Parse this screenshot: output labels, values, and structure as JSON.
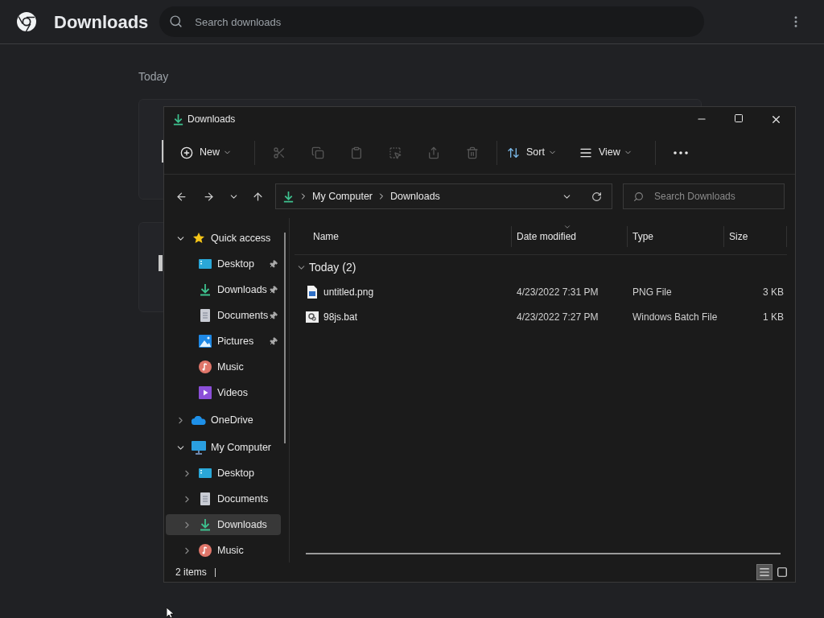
{
  "browser": {
    "title": "Downloads",
    "search": {
      "placeholder": "Search downloads"
    },
    "section": "Today",
    "cards": [
      {
        "kind": "download"
      },
      {
        "kind": "download"
      }
    ]
  },
  "explorer": {
    "title": "Downloads",
    "toolbar": [
      {
        "kind": "new",
        "label": "New",
        "disabled": false
      },
      {
        "kind": "cut",
        "disabled": true
      },
      {
        "kind": "copy",
        "disabled": true
      },
      {
        "kind": "paste",
        "disabled": true
      },
      {
        "kind": "rename",
        "disabled": true
      },
      {
        "kind": "share",
        "disabled": true
      },
      {
        "kind": "delete",
        "disabled": true
      },
      {
        "kind": "sort",
        "label": "Sort",
        "disabled": false
      },
      {
        "kind": "view",
        "label": "View",
        "disabled": false
      },
      {
        "kind": "more",
        "disabled": false
      }
    ],
    "breadcrumb": [
      "My Computer",
      "Downloads"
    ],
    "search": {
      "placeholder": "Search Downloads"
    },
    "tree": [
      {
        "label": "Quick access",
        "kind": "star",
        "expanded": true,
        "selected": false,
        "children": [
          {
            "label": "Desktop",
            "kind": "desktop",
            "pinned": true,
            "selected": false
          },
          {
            "label": "Downloads",
            "kind": "download",
            "pinned": true,
            "selected": false
          },
          {
            "label": "Documents",
            "kind": "document",
            "pinned": true,
            "selected": false
          },
          {
            "label": "Pictures",
            "kind": "picture",
            "pinned": true,
            "selected": false
          },
          {
            "label": "Music",
            "kind": "music",
            "pinned": false,
            "selected": false
          },
          {
            "label": "Videos",
            "kind": "video",
            "pinned": false,
            "selected": false
          }
        ]
      },
      {
        "label": "OneDrive",
        "kind": "cloud",
        "expanded": false,
        "selected": false
      },
      {
        "label": "My Computer",
        "kind": "computer",
        "expanded": true,
        "selected": false,
        "children": [
          {
            "label": "Desktop",
            "kind": "desktop",
            "expanded": false,
            "selected": false
          },
          {
            "label": "Documents",
            "kind": "document",
            "expanded": false,
            "selected": false
          },
          {
            "label": "Downloads",
            "kind": "download",
            "expanded": false,
            "selected": true
          },
          {
            "label": "Music",
            "kind": "music",
            "expanded": false,
            "selected": false
          }
        ]
      }
    ],
    "columns": [
      "Name",
      "Date modified",
      "Type",
      "Size"
    ],
    "group": {
      "label": "Today (2)",
      "expanded": true
    },
    "files": [
      {
        "name": "untitled.png",
        "kind": "image",
        "date": "4/23/2022 7:31 PM",
        "type": "PNG File",
        "size": "3 KB"
      },
      {
        "name": "98js.bat",
        "kind": "batch",
        "date": "4/23/2022 7:27 PM",
        "type": "Windows Batch File",
        "size": "1 KB"
      }
    ],
    "status": "2 items",
    "views": [
      {
        "kind": "details",
        "selected": true
      },
      {
        "kind": "tiles",
        "selected": false
      }
    ]
  }
}
